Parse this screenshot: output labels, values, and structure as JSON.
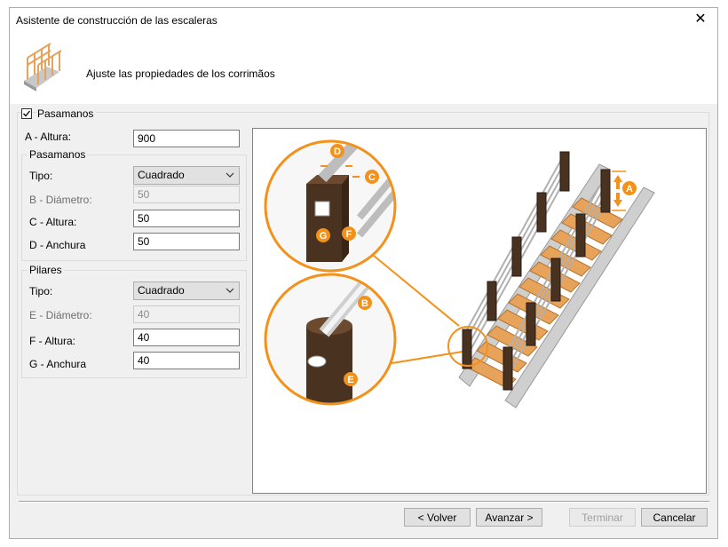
{
  "window": {
    "title": "Asistente de construcción de las escaleras",
    "close_glyph": "✕"
  },
  "header": {
    "icon": "stair-railing-icon",
    "text": "Ajuste las propiedades de los corrimãos"
  },
  "handrails_checkbox": {
    "label": "Pasamanos",
    "checked": true
  },
  "height": {
    "label": "A - Altura:",
    "value": "900"
  },
  "handrail_group": {
    "title": "Pasamanos",
    "type_label": "Tipo:",
    "type_value": "Cuadrado",
    "diameter_label": "B - Diámetro:",
    "diameter_value": "50",
    "height_label": "C - Altura:",
    "height_value": "50",
    "width_label": "D - Anchura",
    "width_value": "50"
  },
  "posts_group": {
    "title": "Pilares",
    "type_label": "Tipo:",
    "type_value": "Cuadrado",
    "diameter_label": "E - Diámetro:",
    "diameter_value": "40",
    "height_label": "F - Altura:",
    "height_value": "40",
    "width_label": "G - Anchura",
    "width_value": "40"
  },
  "preview": {
    "callouts": [
      "A",
      "B",
      "C",
      "D",
      "E",
      "F",
      "G"
    ],
    "colors": {
      "accent": "#f2921b",
      "wood": "#4a3220",
      "step": "#e8a35a",
      "rail": "#b8b8b8"
    }
  },
  "buttons": {
    "back": "< Volver",
    "next": "Avanzar >",
    "finish": "Terminar",
    "cancel": "Cancelar"
  }
}
